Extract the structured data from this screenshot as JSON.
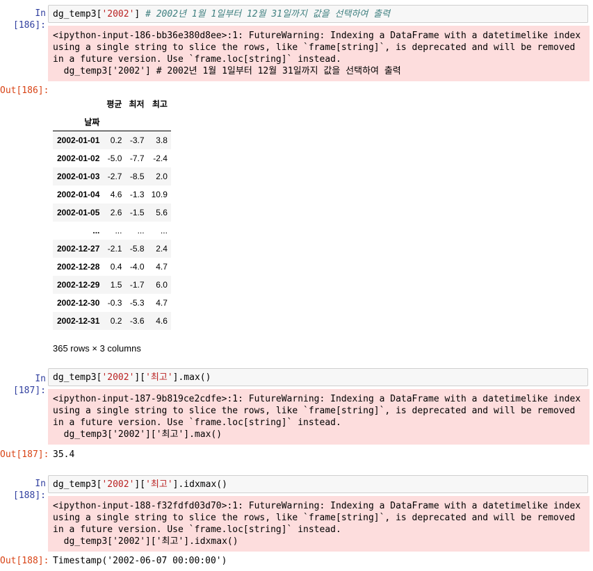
{
  "cells": [
    {
      "in_prompt": "In [186]:",
      "code": {
        "var": "dg_temp3[",
        "str1": "'2002'",
        "close": "]",
        "comment": "# 2002년 1월 1일부터 12월 31일까지 값을 선택하여 출력"
      },
      "warning": "<ipython-input-186-bb36e380d8ee>:1: FutureWarning: Indexing a DataFrame with a datetimelike index using a single string to slice the rows, like `frame[string]`, is deprecated and will be removed in a future version. Use `frame.loc[string]` instead.\n  dg_temp3['2002'] # 2002년 1월 1일부터 12월 31일까지 값을 선택하여 출력",
      "out_prompt": "Out[186]:"
    },
    {
      "in_prompt": "In [187]:",
      "code": {
        "var": "dg_temp3[",
        "str1": "'2002'",
        "mid": "][",
        "str2": "'최고'",
        "tail": "].max()"
      },
      "warning": "<ipython-input-187-9b819ce2cdfe>:1: FutureWarning: Indexing a DataFrame with a datetimelike index using a single string to slice the rows, like `frame[string]`, is deprecated and will be removed in a future version. Use `frame.loc[string]` instead.\n  dg_temp3['2002']['최고'].max()",
      "out_prompt": "Out[187]:",
      "output": "35.4"
    },
    {
      "in_prompt": "In [188]:",
      "code": {
        "var": "dg_temp3[",
        "str1": "'2002'",
        "mid": "][",
        "str2": "'최고'",
        "tail": "].idxmax()"
      },
      "warning": "<ipython-input-188-f32fdfd03d70>:1: FutureWarning: Indexing a DataFrame with a datetimelike index using a single string to slice the rows, like `frame[string]`, is deprecated and will be removed in a future version. Use `frame.loc[string]` instead.\n  dg_temp3['2002']['최고'].idxmax()",
      "out_prompt": "Out[188]:",
      "output": "Timestamp('2002-06-07 00:00:00')"
    }
  ],
  "dataframe": {
    "columns": [
      "평균",
      "최저",
      "최고"
    ],
    "index_name": "날짜",
    "rows": [
      [
        "2002-01-01",
        "0.2",
        "-3.7",
        "3.8"
      ],
      [
        "2002-01-02",
        "-5.0",
        "-7.7",
        "-2.4"
      ],
      [
        "2002-01-03",
        "-2.7",
        "-8.5",
        "2.0"
      ],
      [
        "2002-01-04",
        "4.6",
        "-1.3",
        "10.9"
      ],
      [
        "2002-01-05",
        "2.6",
        "-1.5",
        "5.6"
      ],
      [
        "...",
        "...",
        "...",
        "..."
      ],
      [
        "2002-12-27",
        "-2.1",
        "-5.8",
        "2.4"
      ],
      [
        "2002-12-28",
        "0.4",
        "-4.0",
        "4.7"
      ],
      [
        "2002-12-29",
        "1.5",
        "-1.7",
        "6.0"
      ],
      [
        "2002-12-30",
        "-0.3",
        "-5.3",
        "4.7"
      ],
      [
        "2002-12-31",
        "0.2",
        "-3.6",
        "4.6"
      ]
    ],
    "shape": "365 rows × 3 columns"
  }
}
